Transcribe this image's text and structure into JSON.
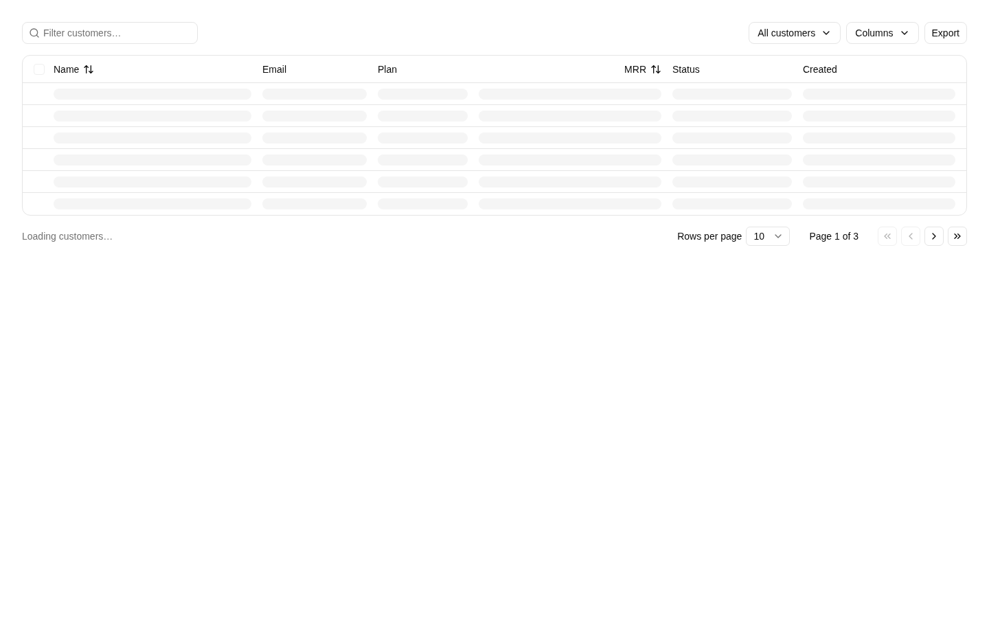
{
  "toolbar": {
    "search": {
      "placeholder": "Filter customers…"
    },
    "buttons": [
      {
        "label": "All customers",
        "kind": "dropdown"
      },
      {
        "label": "Columns",
        "kind": "dropdown"
      },
      {
        "label": "Export",
        "kind": "plain"
      }
    ]
  },
  "table": {
    "select_all": {
      "checked": false,
      "disabled": true
    },
    "columns": [
      {
        "label": "Name",
        "sortable": true,
        "kind": "text"
      },
      {
        "label": "Email",
        "sortable": false,
        "kind": "text"
      },
      {
        "label": "Plan",
        "sortable": false,
        "kind": "text"
      },
      {
        "label": "MRR",
        "sortable": true,
        "kind": "numeric"
      },
      {
        "label": "Status",
        "sortable": false,
        "kind": "text"
      },
      {
        "label": "Created",
        "sortable": false,
        "kind": "text"
      }
    ],
    "rows": [
      {
        "kind": "skeleton"
      },
      {
        "kind": "skeleton"
      },
      {
        "kind": "skeleton"
      },
      {
        "kind": "skeleton"
      },
      {
        "kind": "skeleton"
      },
      {
        "kind": "skeleton"
      }
    ]
  },
  "footer": {
    "status": "Loading customers…",
    "rows_per_page": {
      "label": "Rows per page",
      "value": "10"
    },
    "page_info": "Page 1 of 3",
    "page_buttons": [
      {
        "kind": "first",
        "disabled": true
      },
      {
        "kind": "previous",
        "disabled": true
      },
      {
        "kind": "next",
        "disabled": false
      },
      {
        "kind": "last",
        "disabled": false
      }
    ]
  }
}
